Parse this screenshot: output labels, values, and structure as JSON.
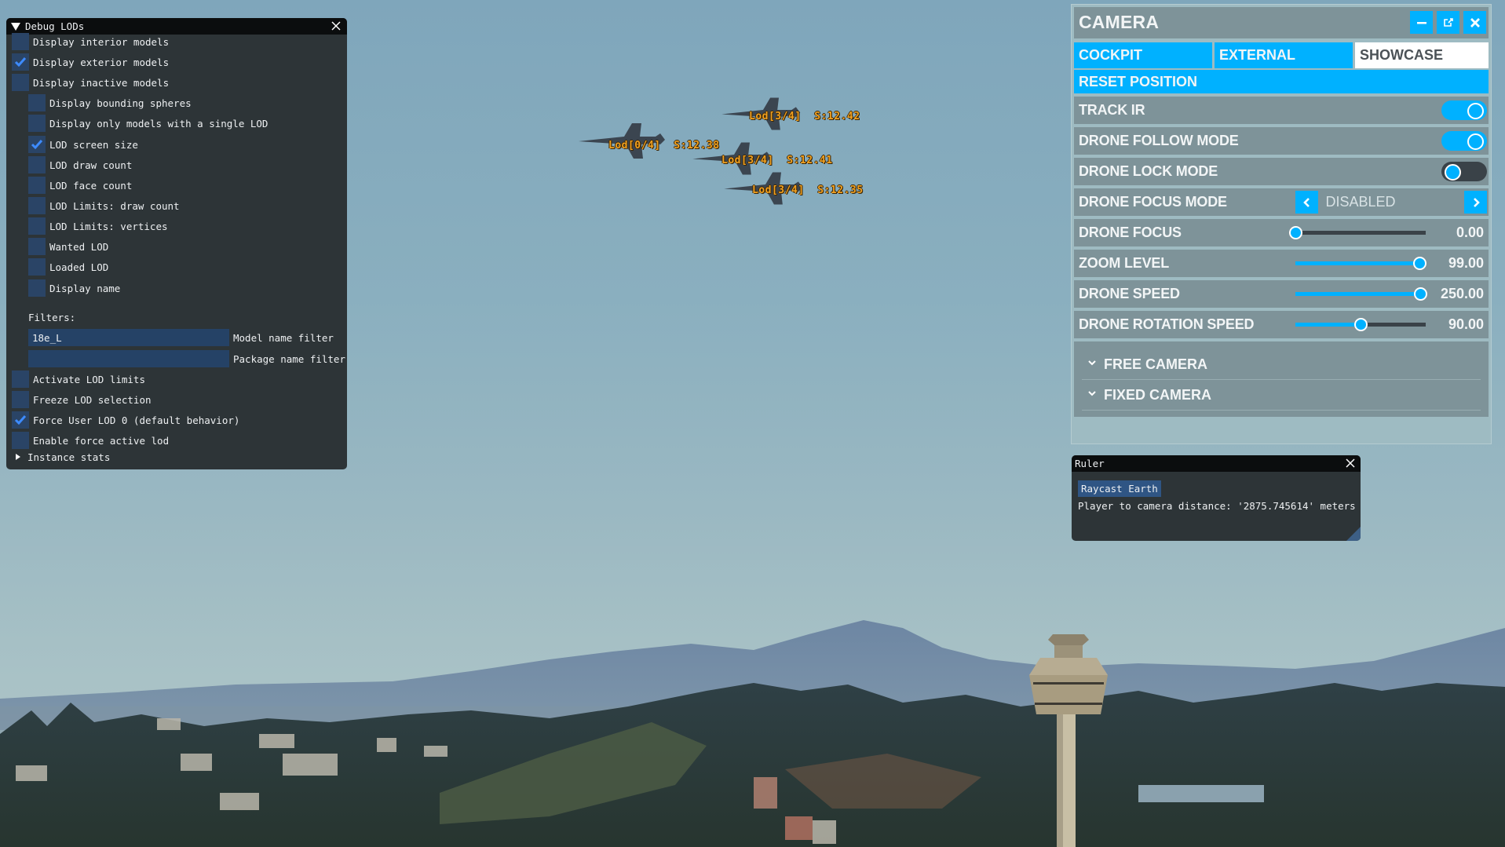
{
  "scene": {
    "description": "Flight simulator view: four jets in formation over a forested valley with mountains and an airport control tower",
    "aircraft_labels": [
      {
        "lod": "Lod[0/4]",
        "size": "S:12.38"
      },
      {
        "lod": "Lod[3/4]",
        "size": "S:12.42"
      },
      {
        "lod": "Lod[3/4]",
        "size": "S:12.41"
      },
      {
        "lod": "Lod[3/4]",
        "size": "S:12.35"
      }
    ]
  },
  "debug_lods": {
    "title": "Debug LODs",
    "options": [
      {
        "label": "Display interior models",
        "checked": false,
        "indent": 0
      },
      {
        "label": "Display exterior models",
        "checked": true,
        "indent": 0
      },
      {
        "label": "Display inactive models",
        "checked": false,
        "indent": 0
      },
      {
        "label": "Display bounding spheres",
        "checked": false,
        "indent": 1
      },
      {
        "label": "Display only models with a single LOD",
        "checked": false,
        "indent": 1
      },
      {
        "label": "LOD screen size",
        "checked": true,
        "indent": 1
      },
      {
        "label": "LOD draw count",
        "checked": false,
        "indent": 1
      },
      {
        "label": "LOD face count",
        "checked": false,
        "indent": 1
      },
      {
        "label": "LOD Limits: draw count",
        "checked": false,
        "indent": 1
      },
      {
        "label": "LOD Limits: vertices",
        "checked": false,
        "indent": 1
      },
      {
        "label": "Wanted LOD",
        "checked": false,
        "indent": 1
      },
      {
        "label": "Loaded LOD",
        "checked": false,
        "indent": 1
      },
      {
        "label": "Display name",
        "checked": false,
        "indent": 1
      }
    ],
    "filters_label": "Filters:",
    "filters": [
      {
        "label": "Model name filter",
        "value": "18e_L"
      },
      {
        "label": "Package name filter",
        "value": ""
      }
    ],
    "options_after": [
      {
        "label": "Activate LOD limits",
        "checked": false
      },
      {
        "label": "Freeze LOD selection",
        "checked": false
      },
      {
        "label": "Force User LOD 0 (default behavior)",
        "checked": true
      },
      {
        "label": "Enable force active lod",
        "checked": false
      }
    ],
    "instance_stats_label": "Instance stats"
  },
  "camera": {
    "title": "CAMERA",
    "tabs": [
      {
        "label": "COCKPIT",
        "active": false
      },
      {
        "label": "EXTERNAL",
        "active": false
      },
      {
        "label": "SHOWCASE",
        "active": true
      }
    ],
    "reset_label": "RESET POSITION",
    "toggles": [
      {
        "label": "TRACK IR",
        "on": true
      },
      {
        "label": "DRONE FOLLOW MODE",
        "on": true
      },
      {
        "label": "DRONE LOCK MODE",
        "on": false
      }
    ],
    "focus_mode": {
      "label": "DRONE FOCUS MODE",
      "value": "DISABLED"
    },
    "sliders": [
      {
        "label": "DRONE FOCUS",
        "value": "0.00",
        "fraction": 0.0
      },
      {
        "label": "ZOOM LEVEL",
        "value": "99.00",
        "fraction": 0.95
      },
      {
        "label": "DRONE SPEED",
        "value": "250.00",
        "fraction": 0.96
      },
      {
        "label": "DRONE ROTATION SPEED",
        "value": "90.00",
        "fraction": 0.5
      }
    ],
    "sections": [
      "FREE CAMERA",
      "FIXED CAMERA"
    ],
    "accent_color": "#00b1ff"
  },
  "ruler": {
    "title": "Ruler",
    "raycast_label": "Raycast Earth",
    "distance_text": "Player to camera distance: '2875.745614' meters"
  }
}
